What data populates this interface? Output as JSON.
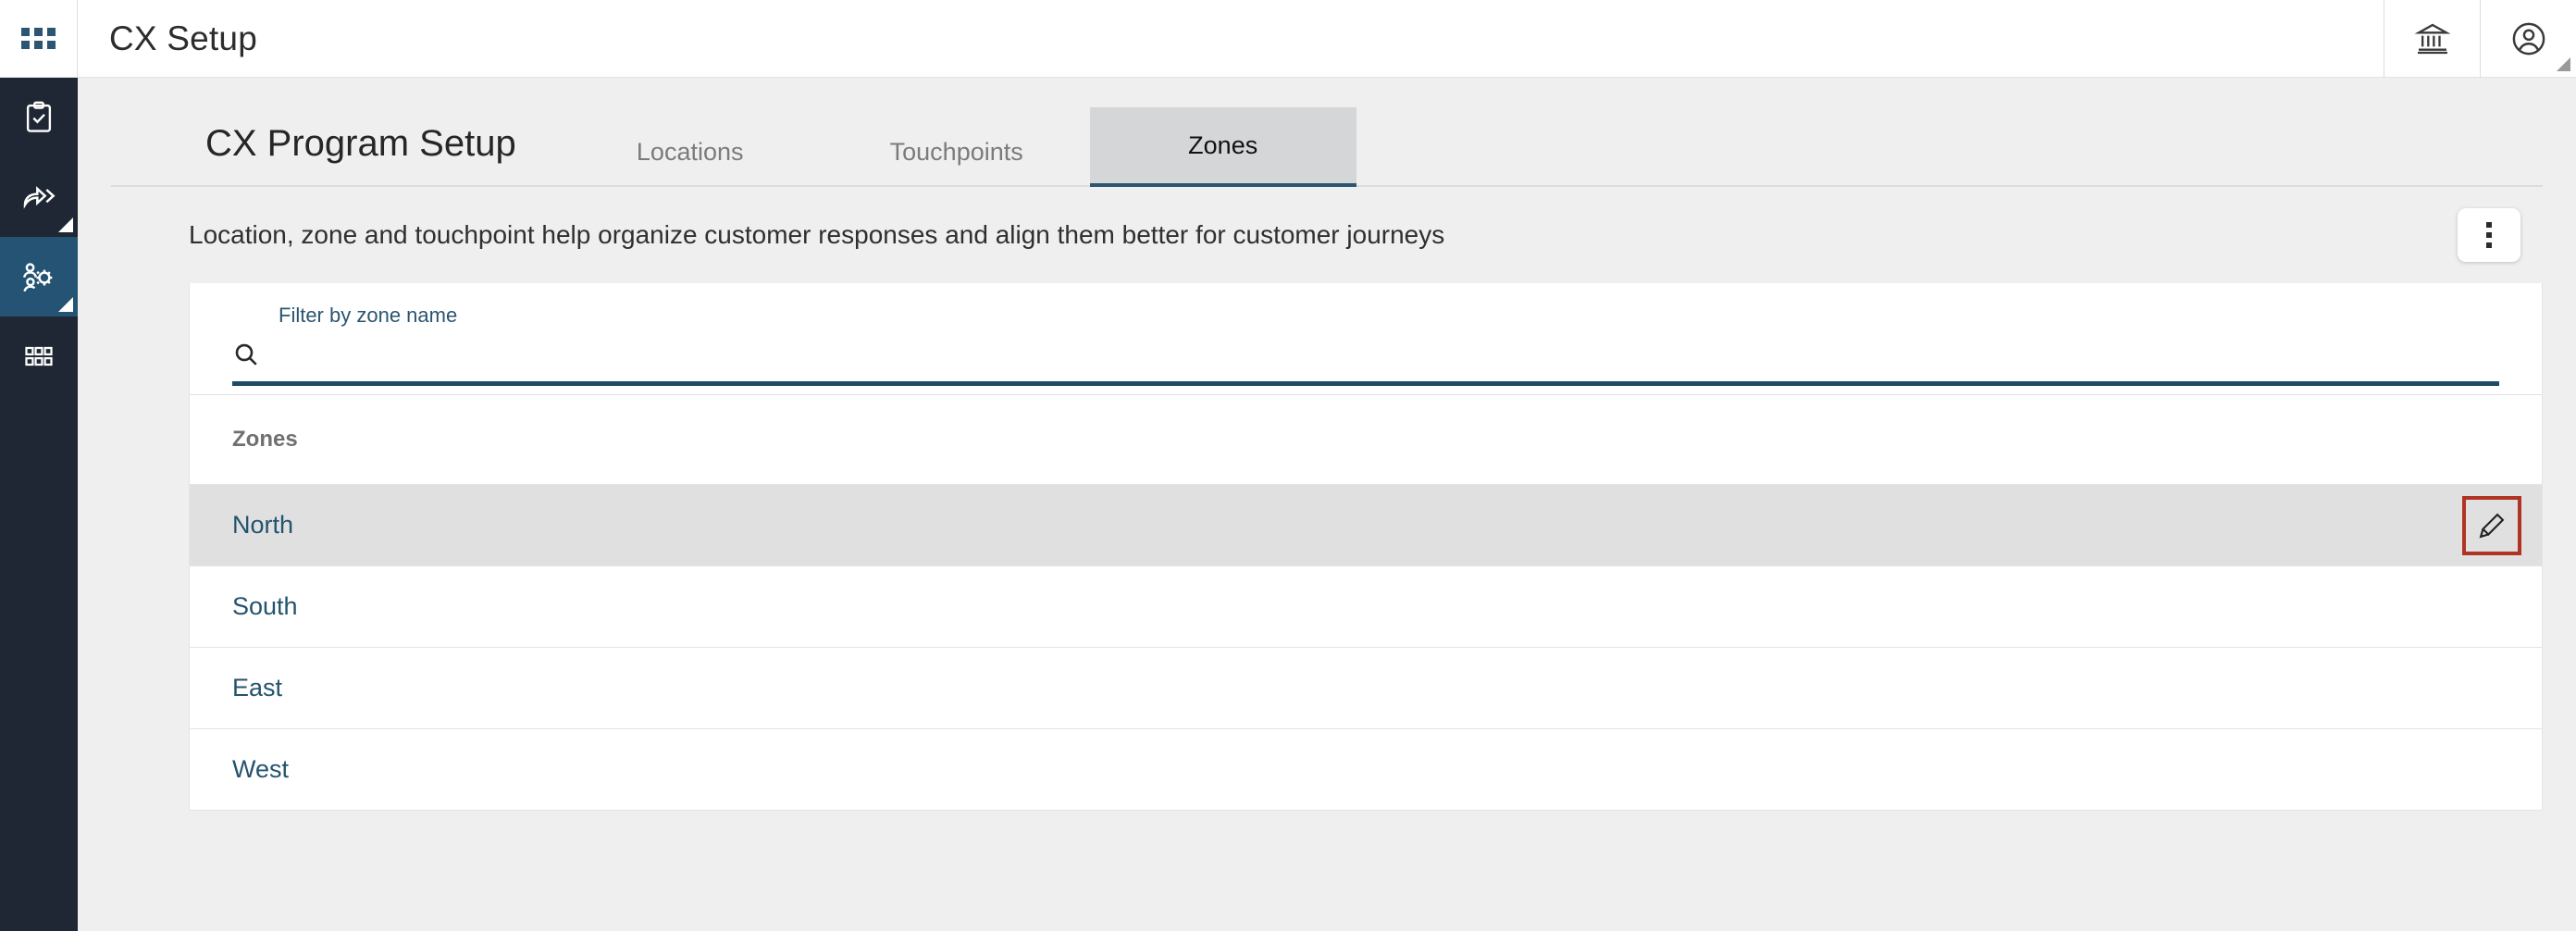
{
  "header": {
    "app_title": "CX Setup",
    "apps_icon": "grid-apps-icon",
    "institution_icon": "bank-institution-icon",
    "account_icon": "user-account-icon"
  },
  "sidebar": {
    "items": [
      {
        "icon": "clipboard-check-icon",
        "active": false,
        "has_corner": false
      },
      {
        "icon": "share-arrow-icon",
        "active": false,
        "has_corner": true
      },
      {
        "icon": "people-gear-icon",
        "active": true,
        "has_corner": true
      },
      {
        "icon": "grid-modules-icon",
        "active": false,
        "has_corner": false
      }
    ]
  },
  "main": {
    "page_title": "CX Program Setup",
    "tabs": [
      {
        "label": "Locations",
        "active": false
      },
      {
        "label": "Touchpoints",
        "active": false
      },
      {
        "label": "Zones",
        "active": true
      }
    ],
    "subtitle": "Location, zone and touchpoint help organize customer responses and align them better for customer journeys",
    "overflow_menu_icon": "kebab-menu-icon"
  },
  "filter": {
    "label": "Filter by zone name",
    "value": "",
    "placeholder": "",
    "search_icon": "search-icon"
  },
  "zones_list": {
    "column_header": "Zones",
    "rows": [
      {
        "name": "North",
        "selected": true,
        "action_icon": "edit-pencil-icon",
        "action_highlighted": true
      },
      {
        "name": "South",
        "selected": false,
        "action_icon": "edit-pencil-icon",
        "action_highlighted": false
      },
      {
        "name": "East",
        "selected": false,
        "action_icon": "edit-pencil-icon",
        "action_highlighted": false
      },
      {
        "name": "West",
        "selected": false,
        "action_icon": "edit-pencil-icon",
        "action_highlighted": false
      }
    ]
  },
  "colors": {
    "rail_bg": "#1e2733",
    "rail_active": "#245373",
    "accent_blue": "#2b5570",
    "link_blue": "#24536e",
    "underline": "#1d4a66",
    "tab_active_bg": "#d4d6d8",
    "highlight_box": "#b03323",
    "page_bg": "#efefef"
  }
}
